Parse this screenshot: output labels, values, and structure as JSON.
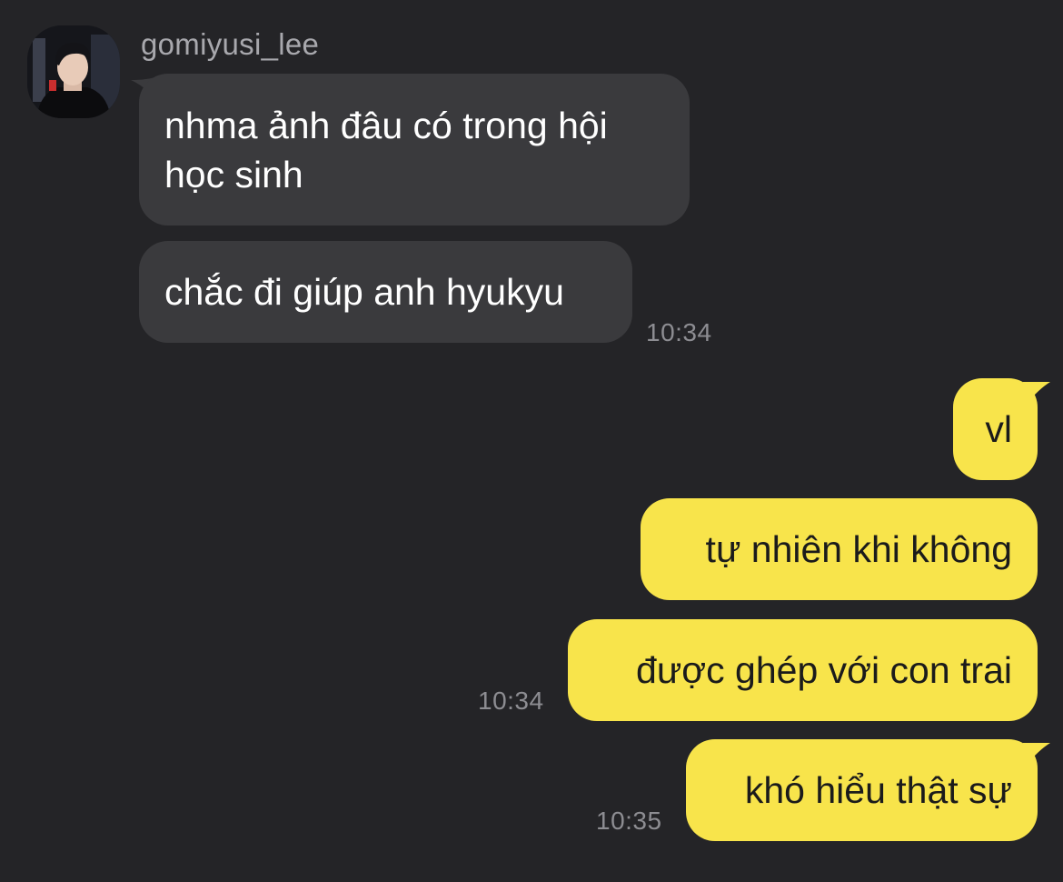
{
  "chat": {
    "sender": {
      "name": "gomiyusi_lee"
    },
    "incoming": [
      {
        "text": "nhma ảnh đâu có trong hội học sinh"
      },
      {
        "text": "chắc đi giúp anh hyukyu"
      }
    ],
    "incoming_time": "10:34",
    "outgoing": [
      {
        "text": "vl"
      },
      {
        "text": "tự nhiên khi không"
      },
      {
        "text": "được ghép với con trai"
      },
      {
        "text": "khó hiểu thật sự"
      }
    ],
    "outgoing_time_1": "10:34",
    "outgoing_time_2": "10:35"
  },
  "colors": {
    "background": "#242427",
    "incoming_bubble": "#3a3a3d",
    "outgoing_bubble": "#f8e44b",
    "timestamp": "#8d8d92"
  }
}
